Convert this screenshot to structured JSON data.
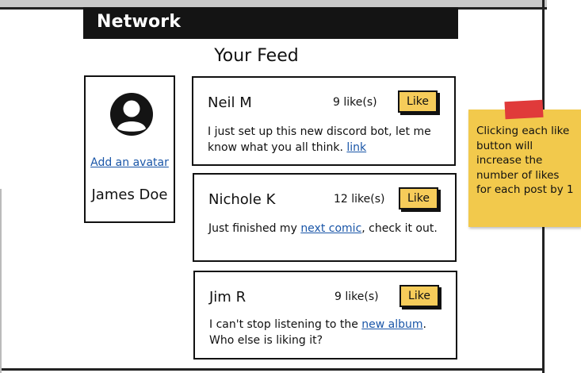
{
  "header": {
    "title": "Network"
  },
  "feed": {
    "title": "Your Feed"
  },
  "profile": {
    "avatar_icon": "user-circle-icon",
    "add_avatar_label": "Add an avatar",
    "name": "James Doe"
  },
  "posts": [
    {
      "author": "Neil M",
      "likes": "9 like(s)",
      "like_label": "Like",
      "text_before": "I just set up this new discord bot, let me know what you all think. ",
      "link_text": "link",
      "text_after": ""
    },
    {
      "author": "Nichole K",
      "likes": "12 like(s)",
      "like_label": "Like",
      "text_before": "Just finished my ",
      "link_text": "next comic",
      "text_after": ", check it out."
    },
    {
      "author": "Jim R",
      "likes": "9 like(s)",
      "like_label": "Like",
      "text_before": "I can't stop listening to the ",
      "link_text": "new album",
      "text_after": ". Who else is liking it?"
    }
  ],
  "note": {
    "text": "Clicking each like button will increase the number of likes for each post by 1"
  },
  "colors": {
    "header_bg": "#141414",
    "like_button": "#f6cc5a",
    "sticky_note": "#f2c94c",
    "sticky_tape": "#e03a3a",
    "link": "#1a56a8"
  }
}
